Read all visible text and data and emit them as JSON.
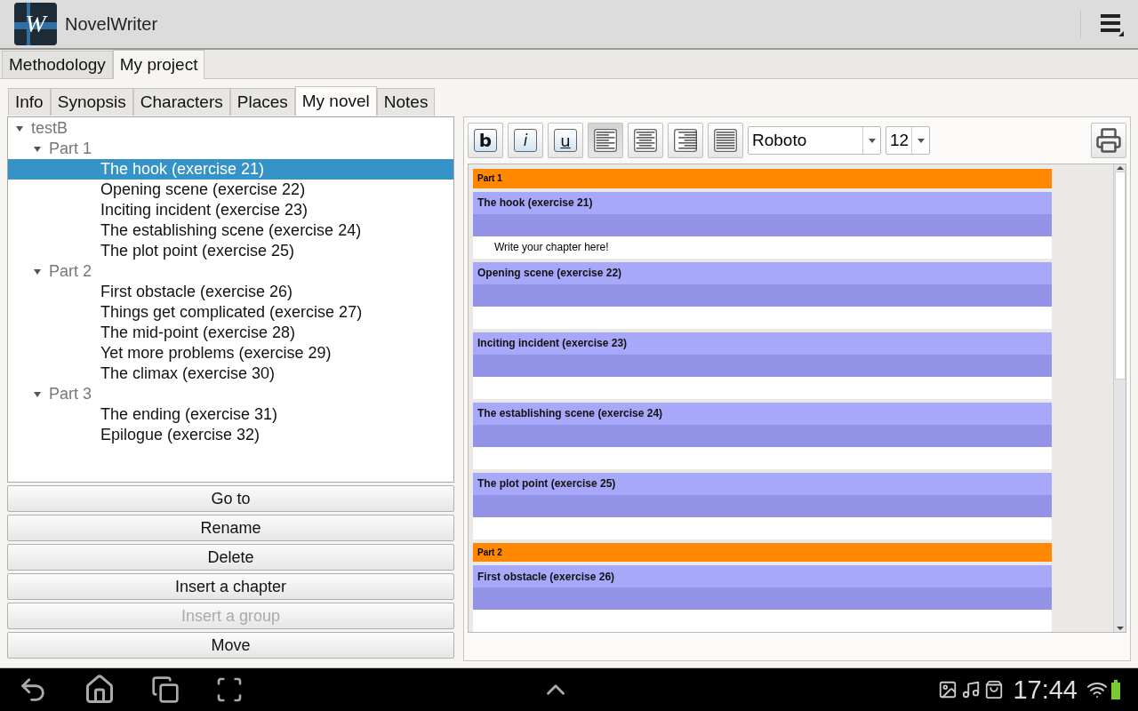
{
  "app_bar": {
    "logo_letter": "W",
    "title": "NovelWriter"
  },
  "top_tabs": [
    {
      "label": "Methodology",
      "selected": false
    },
    {
      "label": "My project",
      "selected": true
    }
  ],
  "project_tabs": [
    {
      "label": "Info",
      "selected": false
    },
    {
      "label": "Synopsis",
      "selected": false
    },
    {
      "label": "Characters",
      "selected": false
    },
    {
      "label": "Places",
      "selected": false
    },
    {
      "label": "My novel",
      "selected": true
    },
    {
      "label": "Notes",
      "selected": false
    }
  ],
  "tree": [
    {
      "label": "testB",
      "expanded": true,
      "children": [
        {
          "label": "Part 1",
          "expanded": true,
          "children": [
            {
              "label": "The hook (exercise 21)",
              "selected": true
            },
            {
              "label": "Opening scene (exercise 22)",
              "selected": false
            },
            {
              "label": "Inciting incident (exercise 23)",
              "selected": false
            },
            {
              "label": "The establishing scene (exercise 24)",
              "selected": false
            },
            {
              "label": "The plot point (exercise 25)",
              "selected": false
            }
          ]
        },
        {
          "label": "Part 2",
          "expanded": true,
          "children": [
            {
              "label": "First obstacle (exercise 26)",
              "selected": false
            },
            {
              "label": "Things get complicated (exercise 27)",
              "selected": false
            },
            {
              "label": "The mid-point (exercise 28)",
              "selected": false
            },
            {
              "label": "Yet more problems (exercise 29)",
              "selected": false
            },
            {
              "label": "The climax (exercise 30)",
              "selected": false
            }
          ]
        },
        {
          "label": "Part 3",
          "expanded": true,
          "children": [
            {
              "label": "The ending (exercise 31)",
              "selected": false
            },
            {
              "label": "Epilogue (exercise 32)",
              "selected": false
            }
          ]
        }
      ]
    }
  ],
  "actions": [
    {
      "label": "Go to",
      "disabled": false
    },
    {
      "label": "Rename",
      "disabled": false
    },
    {
      "label": "Delete",
      "disabled": false
    },
    {
      "label": "Insert a chapter",
      "disabled": false
    },
    {
      "label": "Insert a group",
      "disabled": true
    },
    {
      "label": "Move",
      "disabled": false
    }
  ],
  "toolbar": {
    "format_buttons": [
      {
        "kind": "bold",
        "label": "b",
        "selected": false
      },
      {
        "kind": "italic",
        "label": "i",
        "selected": false
      },
      {
        "kind": "underline",
        "label": "u",
        "selected": false
      },
      {
        "kind": "align-left",
        "selected": true
      },
      {
        "kind": "align-center",
        "selected": false
      },
      {
        "kind": "align-right",
        "selected": false
      },
      {
        "kind": "justify",
        "selected": false
      }
    ],
    "font": "Roboto",
    "size": "12"
  },
  "document": [
    {
      "part": "Part 1",
      "chapters": [
        {
          "title": "The hook (exercise 21)",
          "text": "Write your chapter here!"
        },
        {
          "title": "Opening scene (exercise 22)"
        },
        {
          "title": "Inciting incident (exercise 23)"
        },
        {
          "title": "The establishing scene (exercise 24)"
        },
        {
          "title": "The plot point (exercise 25)"
        }
      ]
    },
    {
      "part": "Part 2",
      "chapters": [
        {
          "title": "First obstacle (exercise 26)"
        }
      ]
    }
  ],
  "status_bar": {
    "time": "17:44"
  }
}
